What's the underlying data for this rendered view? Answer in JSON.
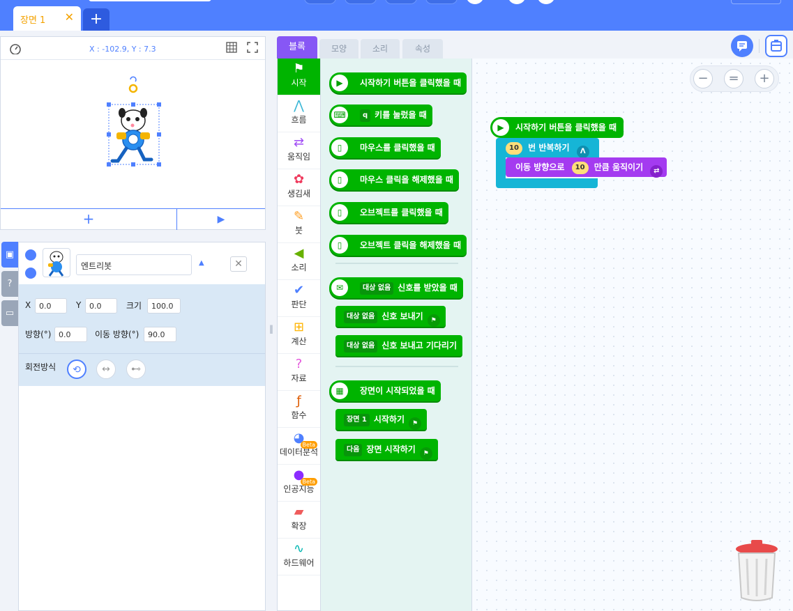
{
  "scene_tabs": {
    "active_label": "장면 1",
    "add_label": "+"
  },
  "stage": {
    "coord_text": "X : -102.9, Y : 7.3",
    "add_label": "+",
    "play_label": "▶"
  },
  "object": {
    "name": "엔트리봇",
    "labels": {
      "x": "X",
      "y": "Y",
      "size": "크기",
      "direction": "방향(°)",
      "move_direction": "이동 방향(°)",
      "rotation": "회전방식"
    },
    "values": {
      "x": "0.0",
      "y": "0.0",
      "size": "100.0",
      "direction": "0.0",
      "move_direction": "90.0"
    }
  },
  "block_tabs": [
    "블록",
    "모양",
    "소리",
    "속성"
  ],
  "categories": [
    {
      "label": "시작",
      "icon": "flag-icon",
      "color": "#ffffff",
      "active": true
    },
    {
      "label": "흐름",
      "icon": "flow-icon",
      "color": "#3bb7d6"
    },
    {
      "label": "움직임",
      "icon": "move-icon",
      "color": "#a14cf5"
    },
    {
      "label": "생김새",
      "icon": "looks-icon",
      "color": "#ef3a5d"
    },
    {
      "label": "붓",
      "icon": "brush-icon",
      "color": "#ff9e20"
    },
    {
      "label": "소리",
      "icon": "sound-icon",
      "color": "#67b100"
    },
    {
      "label": "판단",
      "icon": "judge-icon",
      "color": "#4f80ff"
    },
    {
      "label": "계산",
      "icon": "calc-icon",
      "color": "#ffb400"
    },
    {
      "label": "자료",
      "icon": "data-icon",
      "color": "#e457dc"
    },
    {
      "label": "함수",
      "icon": "function-icon",
      "color": "#de5c04"
    },
    {
      "label": "데이터분석",
      "icon": "analysis-icon",
      "color": "#4f80ff",
      "beta": "Beta"
    },
    {
      "label": "인공지능",
      "icon": "ai-icon",
      "color": "#8b2cff",
      "beta": "Beta"
    },
    {
      "label": "확장",
      "icon": "extension-icon",
      "color": "#ef5b5b"
    },
    {
      "label": "하드웨어",
      "icon": "hardware-icon",
      "color": "#00b6b1"
    }
  ],
  "palette_blocks": [
    {
      "text": "시작하기 버튼을 클릭했을 때",
      "icon": "play-icon"
    },
    {
      "chip": "q",
      "text": "키를 눌렀을 때",
      "icon": "keyboard-icon"
    },
    {
      "text": "마우스를 클릭했을 때",
      "icon": "mouse-icon"
    },
    {
      "text": "마우스 클릭을 해제했을 때",
      "icon": "mouse-icon"
    },
    {
      "text": "오브젝트를 클릭했을 때",
      "icon": "mouse-icon"
    },
    {
      "text": "오브젝트 클릭을 해제했을 때",
      "icon": "mouse-icon"
    },
    {
      "chip": "대상 없음",
      "text": "신호를 받았을 때",
      "icon": "signal-icon"
    },
    {
      "chip": "대상 없음",
      "text": "신호 보내기"
    },
    {
      "chip": "대상 없음",
      "text": "신호 보내고 기다리기"
    },
    {
      "text": "장면이 시작되었을 때",
      "icon": "scene-icon"
    },
    {
      "chip": "장면 1",
      "text": "시작하기"
    },
    {
      "chip": "다음",
      "text": "장면 시작하기"
    }
  ],
  "workspace": {
    "start_block": "시작하기 버튼을 클릭했을 때",
    "repeat_count": "10",
    "repeat_text": "번 반복하기",
    "move_text_before": "이동 방향으로",
    "move_value": "10",
    "move_text_after": "만큼 움직이기",
    "zoom": {
      "minus": "−",
      "equal": "=",
      "plus": "+"
    }
  }
}
